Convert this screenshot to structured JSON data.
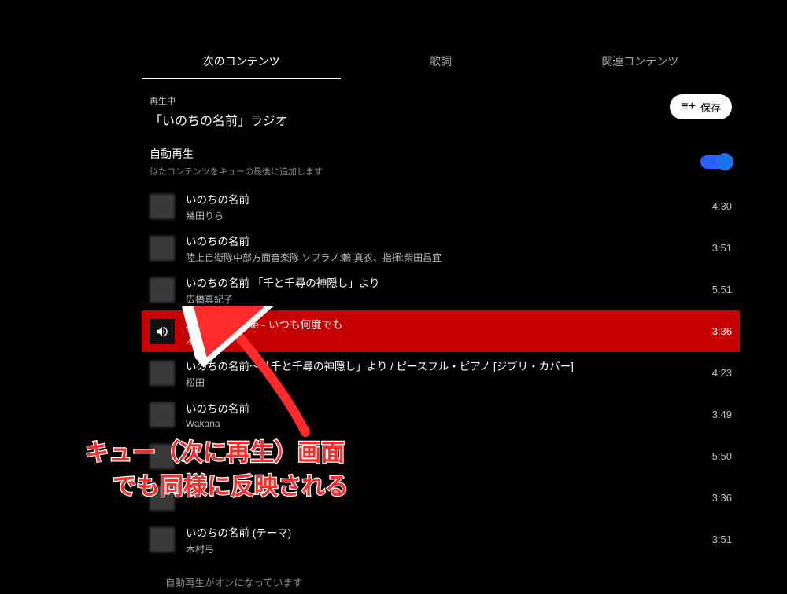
{
  "tabs": {
    "upnext": "次のコンテンツ",
    "lyrics": "歌詞",
    "related": "関連コンテンツ"
  },
  "now_playing_label": "再生中",
  "now_playing_title": "「いのちの名前」ラジオ",
  "save_button": "保存",
  "autoplay": {
    "title": "自動再生",
    "subtitle": "似たコンテンツをキューの最後に追加します"
  },
  "tracks": [
    {
      "title": "いのちの名前",
      "artist": "幾田りら",
      "duration": "4:30",
      "active": false
    },
    {
      "title": "いのちの名前",
      "artist": "陸上自衛隊中部方面音楽隊 ソプラノ:鶫 真衣、指揮:柴田昌宜",
      "duration": "3:51",
      "active": false
    },
    {
      "title": "いのちの名前 「千と千尋の神隠し」より",
      "artist": "広橋真紀子",
      "duration": "5:51",
      "active": false
    },
    {
      "title": "Always with Me - いつも何度でも",
      "artist": "木村弓",
      "duration": "3:36",
      "active": true
    },
    {
      "title": "いのちの名前～「千と千尋の神隠し」より / ピースフル・ピアノ [ジブリ・カバー]",
      "artist": "松田",
      "duration": "4:23",
      "active": false
    },
    {
      "title": "いのちの名前",
      "artist": "Wakana",
      "duration": "3:49",
      "active": false
    },
    {
      "title": "",
      "artist": "",
      "duration": "5:50",
      "active": false
    },
    {
      "title": "",
      "artist": "",
      "duration": "3:36",
      "active": false
    },
    {
      "title": "いのちの名前 (テーマ)",
      "artist": "木村弓",
      "duration": "3:51",
      "active": false
    }
  ],
  "footer": "自動再生がオンになっています",
  "annotation": {
    "line1": "キュー（次に再生）画面",
    "line2": "でも同様に反映される"
  },
  "colors": {
    "active_row": "#c60000",
    "annotation_fill": "#ff2a2a",
    "toggle_on": "#1a73e8"
  }
}
